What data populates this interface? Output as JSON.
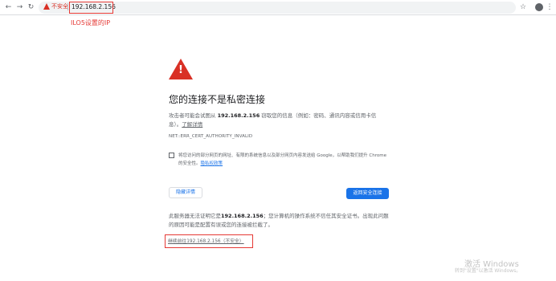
{
  "toolbar": {
    "back_icon": "arrow-left-icon",
    "forward_icon": "arrow-right-icon",
    "reload_icon": "reload-icon",
    "security_label": "不安全",
    "url": "192.168.2.156",
    "bookmark_icon": "star-icon",
    "profile_icon": "avatar-icon",
    "menu_icon": "kebab-menu-icon"
  },
  "annotation": {
    "label": "ILO5设置的IP",
    "color": "#e53935"
  },
  "interstitial": {
    "warning_icon": "warning-triangle-icon",
    "title": "您的连接不是私密连接",
    "para_prefix": "攻击者可能会试图从 ",
    "para_host": "192.168.2.156",
    "para_suffix": " 窃取您的信息（例如：密码、通讯内容或信用卡信息）。",
    "learn_more": "了解详情",
    "error_code": "NET::ERR_CERT_AUTHORITY_INVALID",
    "checkbox_text": "将您访问的部分网页的网址、有限的系统信息以及部分网页内容发送给 Google，以帮助我们提升 Chrome 的安全性。",
    "privacy_link": "隐私权政策",
    "hide_button": "隐藏详情",
    "back_button": "返回安全连接",
    "detail_prefix": "此服务器无法证明它是",
    "detail_host": "192.168.2.156",
    "detail_suffix": "；您计算机的操作系统不信任其安全证书。出现此问题的原因可能是配置有误或您的连接被拦截了。",
    "proceed_link": "继续前往192.168.2.156（不安全）",
    "accent_color": "#1a73e8",
    "danger_color": "#d93025"
  },
  "watermark": {
    "line1": "激活 Windows",
    "line2": "转到\"设置\"以激活 Windows。"
  }
}
